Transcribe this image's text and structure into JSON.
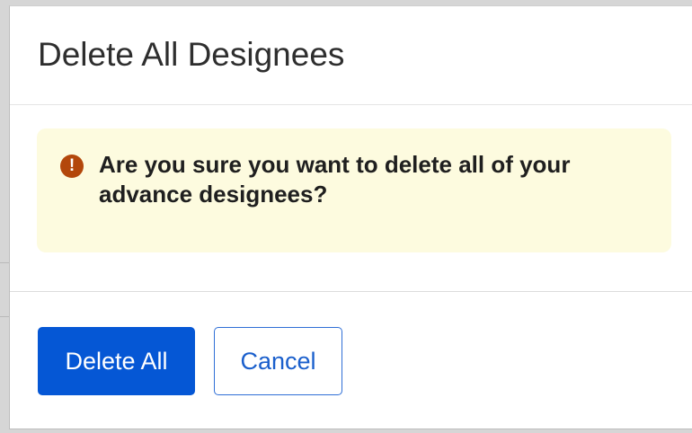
{
  "dialog": {
    "title": "Delete All Designees",
    "alert": {
      "icon": "exclamation-icon",
      "icon_glyph": "!",
      "message": "Are you sure you want to delete all of your advance designees?",
      "background_color": "#fdfbdf",
      "icon_color": "#b3470b"
    },
    "buttons": {
      "confirm_label": "Delete All",
      "cancel_label": "Cancel"
    },
    "colors": {
      "primary": "#0557d5",
      "secondary_border": "#2f6fd6"
    }
  }
}
